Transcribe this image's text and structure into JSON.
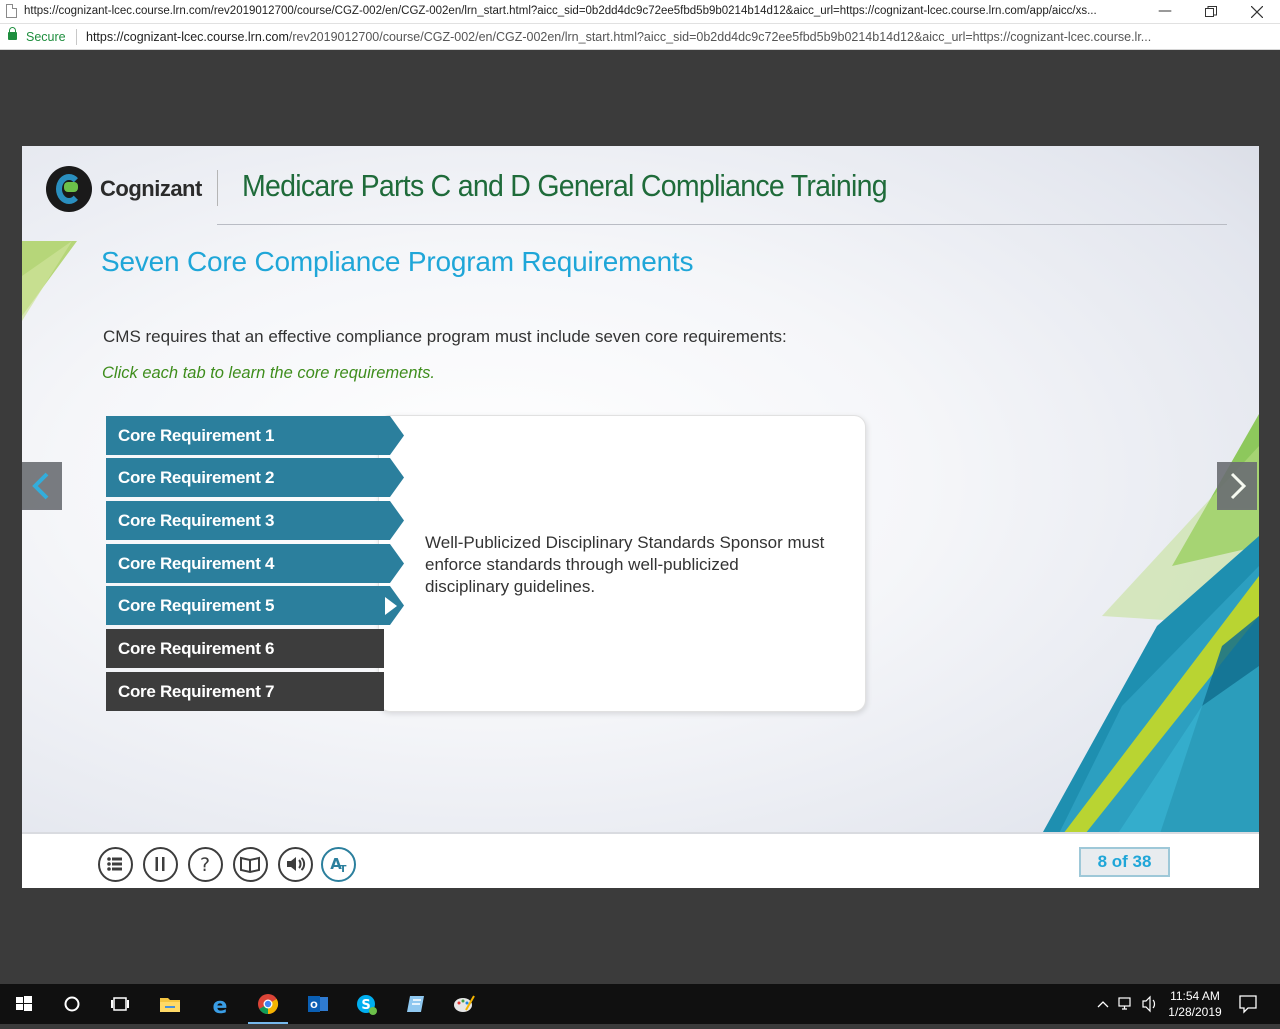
{
  "browser": {
    "title": "https://cognizant-lcec.course.lrn.com/rev2019012700/course/CGZ-002/en/CGZ-002en/lrn_start.html?aicc_sid=0b2dd4dc9c72ee5fbd5b9b0214b14d12&aicc_url=https://cognizant-lcec.course.lrn.com/app/aicc/xs...",
    "secure_label": "Secure",
    "url_host": "https://cognizant-lcec.course.lrn.com",
    "url_path": "/rev2019012700/course/CGZ-002/en/CGZ-002en/lrn_start.html?aicc_sid=0b2dd4dc9c72ee5fbd5b9b0214b14d12&aicc_url=https://cognizant-lcec.course.lr..."
  },
  "course": {
    "brand": "Cognizant",
    "title": "Medicare Parts C and D General Compliance Training",
    "slide_title": "Seven Core Compliance Program Requirements",
    "intro": "CMS requires that an effective compliance program must include seven core requirements:",
    "instruction": "Click each tab to learn the core requirements.",
    "tabs": [
      {
        "label": "Core Requirement 1"
      },
      {
        "label": "Core Requirement 2"
      },
      {
        "label": "Core Requirement 3"
      },
      {
        "label": "Core Requirement 4"
      },
      {
        "label": "Core Requirement 5"
      },
      {
        "label": "Core Requirement 6"
      },
      {
        "label": "Core Requirement 7"
      }
    ],
    "selected_tab": 5,
    "content": "Well-Publicized Disciplinary Standards Sponsor must enforce standards through well-publicized disciplinary guidelines.",
    "page_indicator": "8 of 38",
    "controls": [
      "menu-icon",
      "pause-icon",
      "help-icon",
      "glossary-book-icon",
      "audio-icon",
      "text-icon"
    ]
  },
  "taskbar": {
    "time": "11:54 AM",
    "date": "1/28/2019"
  },
  "colors": {
    "teal_tab": "#2b7f9d",
    "dark_tab": "#3d3d3d",
    "title_blue": "#1fa6d8",
    "title_green": "#1f6b3a",
    "instruction_green": "#3e8d1c"
  }
}
